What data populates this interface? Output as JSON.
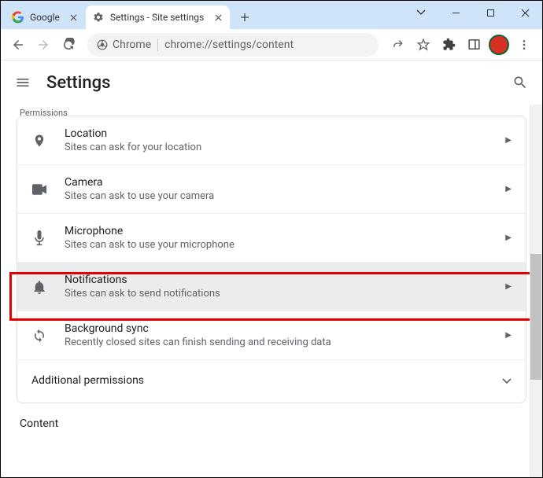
{
  "window": {
    "tabs": [
      {
        "title": "Google"
      },
      {
        "title": "Settings - Site settings"
      }
    ]
  },
  "omnibox": {
    "prefix": "Chrome",
    "url": "chrome://settings/content"
  },
  "header": {
    "title": "Settings"
  },
  "section_permissions": "Permissions",
  "rows": {
    "location": {
      "title": "Location",
      "sub": "Sites can ask for your location"
    },
    "camera": {
      "title": "Camera",
      "sub": "Sites can ask to use your camera"
    },
    "microphone": {
      "title": "Microphone",
      "sub": "Sites can ask to use your microphone"
    },
    "notifications": {
      "title": "Notifications",
      "sub": "Sites can ask to send notifications"
    },
    "bgsync": {
      "title": "Background sync",
      "sub": "Recently closed sites can finish sending and receiving data"
    },
    "additional": {
      "title": "Additional permissions"
    }
  },
  "section_content": "Content"
}
